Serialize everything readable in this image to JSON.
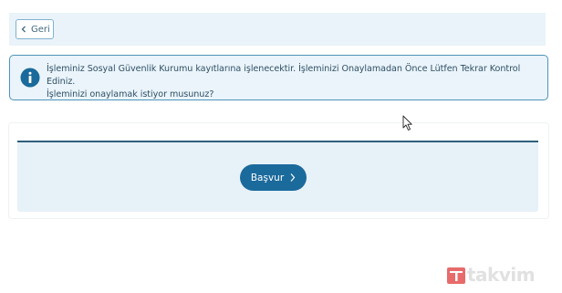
{
  "back_button": {
    "label": "Geri"
  },
  "alert": {
    "icon": "info-icon",
    "line1": "İşleminiz Sosyal Güvenlik Kurumu kayıtlarına işlenecektir. İşleminizi Onaylamadan Önce Lütfen Tekrar Kontrol Ediniz.",
    "line2": "İşleminizi onaylamak istiyor musunuz?"
  },
  "apply_button": {
    "label": "Başvur",
    "icon": "chevron-right-icon"
  },
  "watermark": {
    "text": "takvim"
  },
  "colors": {
    "accent": "#1b6a9c",
    "alert_border": "#4d94b8",
    "panel_bg": "#e7f1f8",
    "text": "#2f4f66"
  }
}
